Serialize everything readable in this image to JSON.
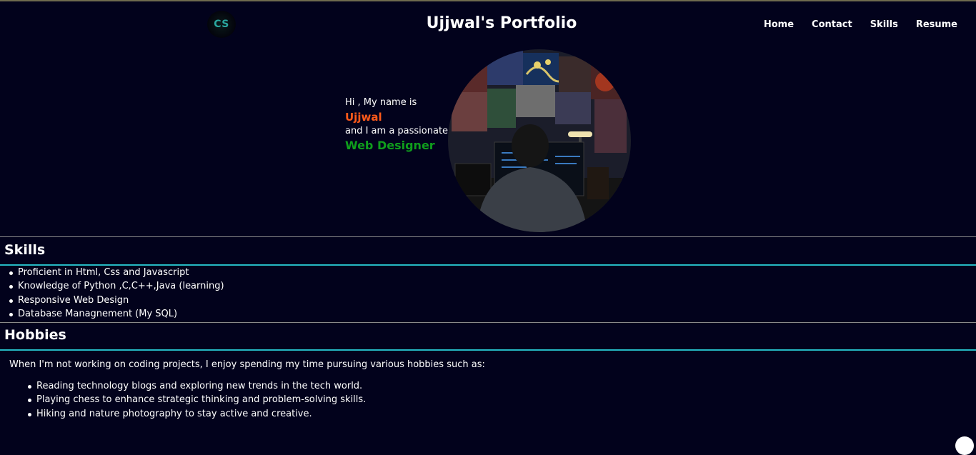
{
  "header": {
    "logo_text": "CS",
    "title": "Ujjwal's Portfolio",
    "nav": [
      {
        "label": "Home"
      },
      {
        "label": "Contact"
      },
      {
        "label": "Skills"
      },
      {
        "label": "Resume"
      }
    ]
  },
  "intro": {
    "line1": "Hi , My name is",
    "name": "Ujjwal",
    "line3": "and I am a passionate",
    "role": "Web Designer"
  },
  "skills": {
    "heading": "Skills",
    "items": [
      "Proficient in Html, Css and Javascript",
      "Knowledge of Python ,C,C++,Java (learning)",
      "Responsive Web Design",
      "Database Managnement (My SQL)"
    ]
  },
  "hobbies": {
    "heading": "Hobbies",
    "intro": "When I'm not working on coding projects, I enjoy spending my time pursuing various hobbies such as:",
    "items": [
      "Reading technology blogs and exploring new trends in the tech world.",
      "Playing chess to enhance strategic thinking and problem-solving skills.",
      "Hiking and nature photography to stay active and creative."
    ]
  },
  "colors": {
    "background": "#02021c",
    "name_accent": "#ff5a1a",
    "role_accent": "#0f9e1c",
    "divider_teal": "#25b9c4"
  }
}
